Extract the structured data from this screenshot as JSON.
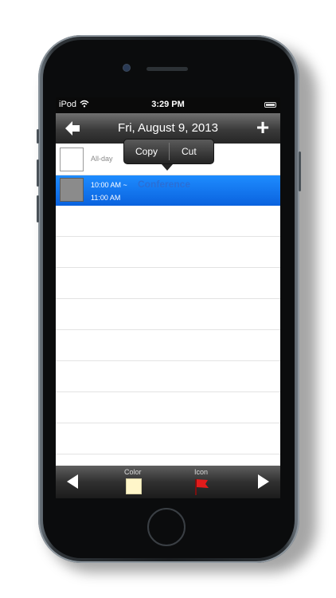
{
  "status_bar": {
    "carrier": "iPod",
    "time": "3:29 PM"
  },
  "nav": {
    "title": "Fri, August 9, 2013",
    "back_icon": "back-arrow-icon",
    "add_icon": "plus-icon",
    "add_label": "+"
  },
  "list": {
    "all_day_label": "All-day",
    "event": {
      "start_time": "10:00 AM ~",
      "end_time": "11:00 AM",
      "title": "Conference",
      "color": "#8b8b8b"
    }
  },
  "context_menu": {
    "items": [
      "Copy",
      "Cut"
    ]
  },
  "toolbar": {
    "color_label": "Color",
    "icon_label": "Icon",
    "selected_color": "#fff6c9",
    "icon": "red-flag-icon"
  },
  "colors": {
    "selection_blue": "#0a62de",
    "bar_dark": "#262626"
  }
}
